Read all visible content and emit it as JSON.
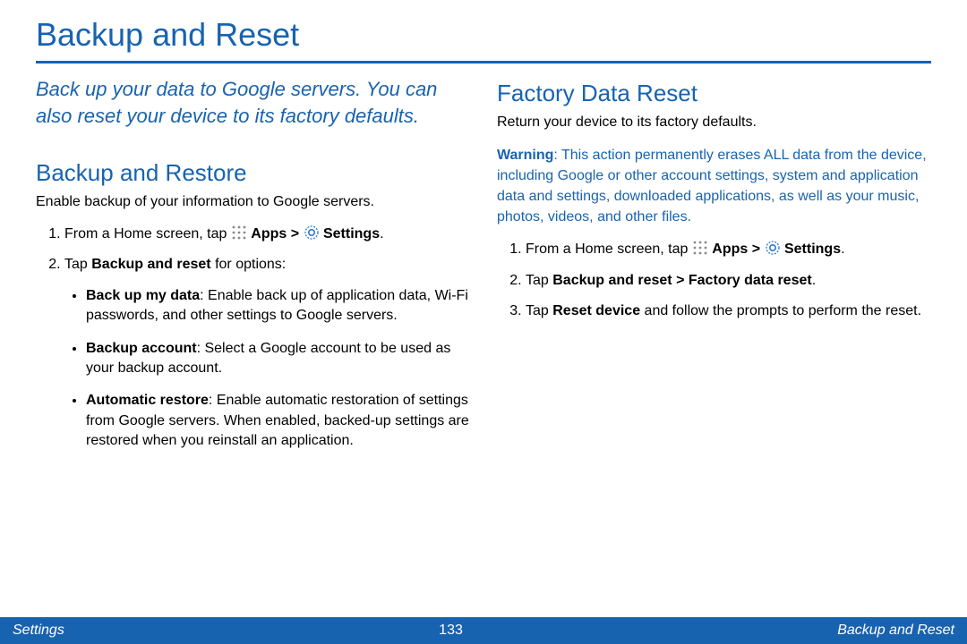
{
  "title": "Backup and Reset",
  "intro": "Back up your data to Google servers. You can also reset your device to its factory defaults.",
  "left": {
    "heading": "Backup and Restore",
    "sub": "Enable backup of your information to Google servers.",
    "step1_pre": "From a Home screen, tap ",
    "apps": "Apps",
    "gt": " > ",
    "settings": "Settings",
    "step2_pre": "Tap ",
    "step2_bold": "Backup and reset",
    "step2_post": " for options:",
    "b1_bold": "Back up my data",
    "b1_rest": ": Enable back up of application data, Wi-Fi passwords, and other settings to Google servers.",
    "b2_bold": "Backup account",
    "b2_rest": ": Select a Google account to be used as your backup account.",
    "b3_bold": "Automatic restore",
    "b3_rest": ": Enable automatic restoration of settings from Google servers. When enabled, backed-up settings are restored when you reinstall an application."
  },
  "right": {
    "heading": "Factory Data Reset",
    "sub": "Return your device to its factory defaults.",
    "warn_bold": "Warning",
    "warn_rest": ": This action permanently erases ALL data from the device, including Google or other account settings, system and application data and settings, downloaded applications, as well as your music, photos, videos, and other files.",
    "step1_pre": "From a Home screen, tap ",
    "apps": "Apps",
    "gt": " > ",
    "settings": "Settings",
    "step2_pre": "Tap ",
    "step2_bold": "Backup and reset > Factory data reset",
    "step3_pre": "Tap ",
    "step3_bold": "Reset device",
    "step3_post": " and follow the prompts to perform the reset."
  },
  "footer": {
    "left": "Settings",
    "page": "133",
    "right": "Backup and Reset"
  }
}
